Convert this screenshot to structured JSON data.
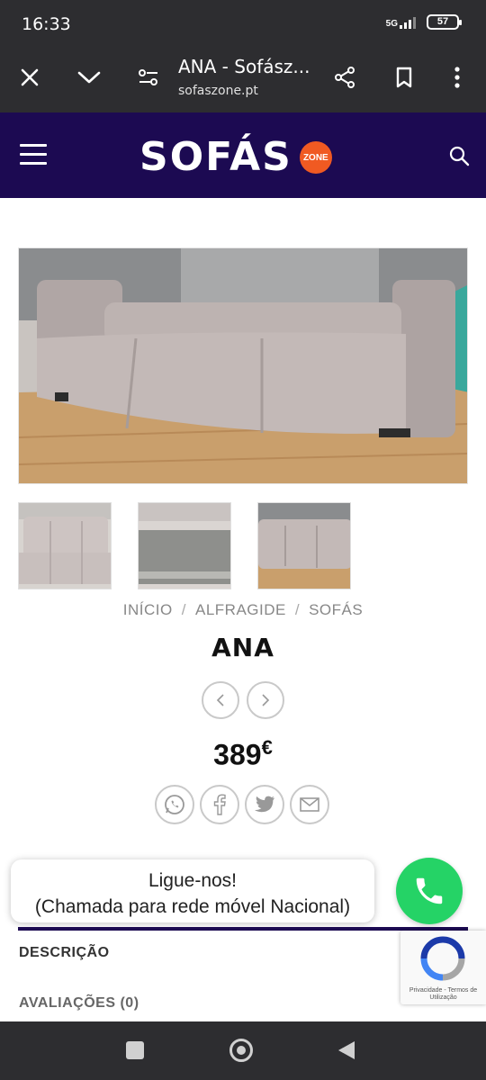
{
  "status_bar": {
    "time": "16:33",
    "network": "5G",
    "battery": "57"
  },
  "browser": {
    "title": "ANA - Sofász...",
    "url": "sofaszone.pt",
    "icons": [
      "close-icon",
      "chevron-down-icon",
      "site-settings-icon",
      "share-icon",
      "bookmark-icon",
      "more-icon"
    ]
  },
  "header": {
    "logo_text": "SOFÁS",
    "logo_badge": "ZONE",
    "brand_color": "#1c0a52",
    "accent_color": "#f05a22"
  },
  "breadcrumb": {
    "items": [
      "INÍCIO",
      "ALFRAGIDE",
      "SOFÁS"
    ],
    "separator": "/"
  },
  "product": {
    "name": "ANA",
    "price": "389",
    "currency": "€"
  },
  "call": {
    "line1": "Ligue-nos!",
    "line2": "(Chamada para rede móvel Nacional)",
    "button_color": "#25d366"
  },
  "tabs": {
    "description": "DESCRIÇÃO",
    "reviews": "AVALIAÇÕES (0)"
  },
  "recaptcha": {
    "links": "Privacidade - Termos de Utilização"
  }
}
